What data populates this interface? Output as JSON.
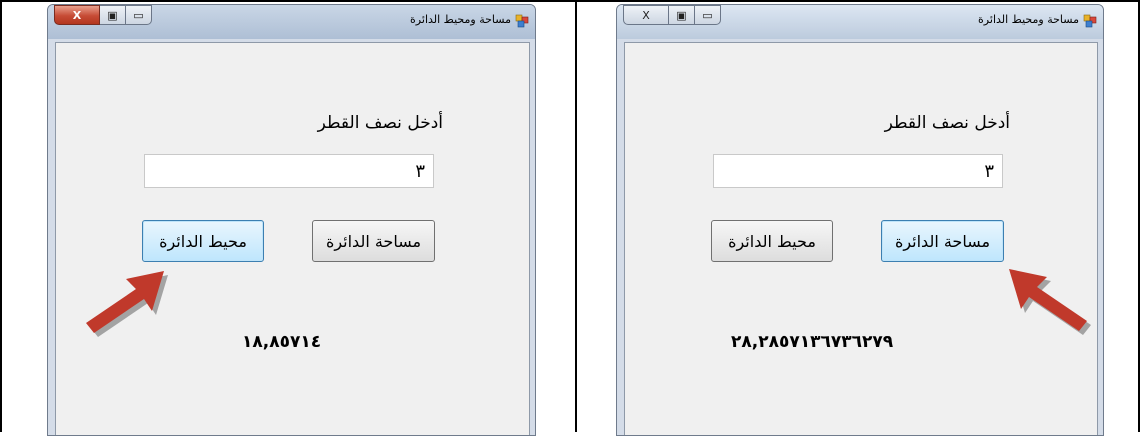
{
  "panels": [
    {
      "window_title": "مساحة ومحيط الدائرة",
      "prompt_label": "أدخل نصف القطر",
      "radius_value": "٣",
      "area_button_label": "مساحة الدائرة",
      "perimeter_button_label": "محيط الدائرة",
      "result_text": "١٨,٨٥٧١٤",
      "focused_button": "perimeter"
    },
    {
      "window_title": "مساحة ومحيط الدائرة",
      "prompt_label": "أدخل نصف القطر",
      "radius_value": "٣",
      "area_button_label": "مساحة الدائرة",
      "perimeter_button_label": "محيط الدائرة",
      "result_text": "٢٨,٢٨٥٧١٣٦٧٣٦٢٧٩",
      "focused_button": "area"
    }
  ],
  "caption_buttons": {
    "close_glyph": "X",
    "maximize_glyph": "▣",
    "minimize_glyph": "▭"
  },
  "colors": {
    "arrow": "#c0392b",
    "focus_border": "#3c7fb1"
  }
}
